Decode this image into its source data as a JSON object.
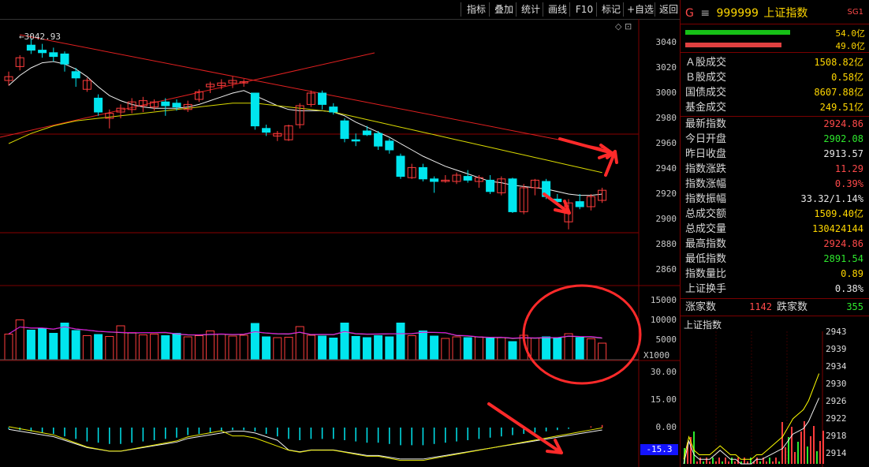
{
  "toolbar": {
    "buttons": [
      "指标",
      "叠加",
      "统计",
      "画线",
      "F10",
      "标记",
      "+自选",
      "返回"
    ]
  },
  "main_chart": {
    "y_ticks": [
      "3040",
      "3020",
      "3000",
      "2980",
      "2960",
      "2940",
      "2920",
      "2900",
      "2880",
      "2860"
    ],
    "high_label": "3042.93",
    "up_color": "#ff3c3c",
    "down_color": "#00e5ee"
  },
  "volume_chart": {
    "y_ticks": [
      "15000",
      "10000",
      "5000"
    ],
    "unit": "X1000"
  },
  "macd_chart": {
    "y_ticks": [
      "30.00",
      "15.00",
      "0.00"
    ],
    "current_value": "-15.3"
  },
  "chart_data": {
    "type": "candlestick",
    "ylim": [
      2850,
      3050
    ],
    "candles": [
      {
        "o": 3010,
        "h": 3017,
        "l": 3006,
        "c": 3013
      },
      {
        "o": 3021,
        "h": 3030,
        "l": 3018,
        "c": 3028
      },
      {
        "o": 3038,
        "h": 3043,
        "l": 3031,
        "c": 3034
      },
      {
        "o": 3034,
        "h": 3039,
        "l": 3028,
        "c": 3032
      },
      {
        "o": 3032,
        "h": 3036,
        "l": 3025,
        "c": 3029
      },
      {
        "o": 3031,
        "h": 3033,
        "l": 3017,
        "c": 3023
      },
      {
        "o": 3017,
        "h": 3020,
        "l": 3005,
        "c": 3012
      },
      {
        "o": 3003,
        "h": 3012,
        "l": 3001,
        "c": 3010
      },
      {
        "o": 2996,
        "h": 2999,
        "l": 2982,
        "c": 2985
      },
      {
        "o": 2980,
        "h": 2987,
        "l": 2972,
        "c": 2984
      },
      {
        "o": 2985,
        "h": 2991,
        "l": 2980,
        "c": 2988
      },
      {
        "o": 2987,
        "h": 2996,
        "l": 2984,
        "c": 2993
      },
      {
        "o": 2990,
        "h": 2997,
        "l": 2985,
        "c": 2994
      },
      {
        "o": 2989,
        "h": 2995,
        "l": 2986,
        "c": 2993
      },
      {
        "o": 2993,
        "h": 2996,
        "l": 2982,
        "c": 2990
      },
      {
        "o": 2992,
        "h": 2995,
        "l": 2986,
        "c": 2989
      },
      {
        "o": 2987,
        "h": 2994,
        "l": 2985,
        "c": 2991
      },
      {
        "o": 2995,
        "h": 3003,
        "l": 2993,
        "c": 3001
      },
      {
        "o": 3005,
        "h": 3009,
        "l": 3000,
        "c": 3007
      },
      {
        "o": 3006,
        "h": 3011,
        "l": 3003,
        "c": 3008
      },
      {
        "o": 3008,
        "h": 3013,
        "l": 3004,
        "c": 3010
      },
      {
        "o": 3008,
        "h": 3011,
        "l": 3005,
        "c": 3009
      },
      {
        "o": 3000,
        "h": 3000,
        "l": 2971,
        "c": 2974
      },
      {
        "o": 2972,
        "h": 2975,
        "l": 2966,
        "c": 2969
      },
      {
        "o": 2966,
        "h": 2970,
        "l": 2962,
        "c": 2968
      },
      {
        "o": 2963,
        "h": 2975,
        "l": 2962,
        "c": 2974
      },
      {
        "o": 2975,
        "h": 2992,
        "l": 2972,
        "c": 2990
      },
      {
        "o": 2991,
        "h": 3002,
        "l": 2989,
        "c": 3000
      },
      {
        "o": 3000,
        "h": 3002,
        "l": 2987,
        "c": 2991
      },
      {
        "o": 2989,
        "h": 2992,
        "l": 2983,
        "c": 2985
      },
      {
        "o": 2978,
        "h": 2980,
        "l": 2961,
        "c": 2964
      },
      {
        "o": 2963,
        "h": 2968,
        "l": 2958,
        "c": 2962
      },
      {
        "o": 2970,
        "h": 2974,
        "l": 2966,
        "c": 2967
      },
      {
        "o": 2968,
        "h": 2970,
        "l": 2955,
        "c": 2958
      },
      {
        "o": 2962,
        "h": 2964,
        "l": 2952,
        "c": 2955
      },
      {
        "o": 2950,
        "h": 2952,
        "l": 2932,
        "c": 2934
      },
      {
        "o": 2933,
        "h": 2944,
        "l": 2932,
        "c": 2941
      },
      {
        "o": 2941,
        "h": 2944,
        "l": 2930,
        "c": 2932
      },
      {
        "o": 2932,
        "h": 2934,
        "l": 2921,
        "c": 2930
      },
      {
        "o": 2930,
        "h": 2935,
        "l": 2929,
        "c": 2931
      },
      {
        "o": 2930,
        "h": 2937,
        "l": 2928,
        "c": 2935
      },
      {
        "o": 2934,
        "h": 2939,
        "l": 2929,
        "c": 2931
      },
      {
        "o": 2930,
        "h": 2935,
        "l": 2925,
        "c": 2933
      },
      {
        "o": 2931,
        "h": 2935,
        "l": 2920,
        "c": 2922
      },
      {
        "o": 2921,
        "h": 2934,
        "l": 2919,
        "c": 2932
      },
      {
        "o": 2932,
        "h": 2933,
        "l": 2905,
        "c": 2906
      },
      {
        "o": 2906,
        "h": 2928,
        "l": 2904,
        "c": 2925
      },
      {
        "o": 2925,
        "h": 2932,
        "l": 2919,
        "c": 2931
      },
      {
        "o": 2930,
        "h": 2932,
        "l": 2916,
        "c": 2918
      },
      {
        "o": 2916,
        "h": 2920,
        "l": 2912,
        "c": 2914
      },
      {
        "o": 2898,
        "h": 2916,
        "l": 2892,
        "c": 2913
      },
      {
        "o": 2914,
        "h": 2920,
        "l": 2908,
        "c": 2910
      },
      {
        "o": 2910,
        "h": 2920,
        "l": 2907,
        "c": 2918
      },
      {
        "o": 2915,
        "h": 2925,
        "l": 2913,
        "c": 2923
      }
    ],
    "ma_white": [
      3006,
      3014,
      3020,
      3024,
      3025,
      3023,
      3019,
      3013,
      3005,
      2998,
      2994,
      2991,
      2989,
      2988,
      2988,
      2988,
      2989,
      2991,
      2994,
      2997,
      3000,
      3002,
      2998,
      2994,
      2990,
      2987,
      2986,
      2986,
      2986,
      2985,
      2982,
      2977,
      2973,
      2969,
      2965,
      2960,
      2955,
      2950,
      2946,
      2942,
      2939,
      2936,
      2933,
      2930,
      2929,
      2927,
      2926,
      2925,
      2924,
      2922,
      2920,
      2919,
      2919,
      2920
    ],
    "ma_yellow": [
      2960,
      2964,
      2968,
      2971,
      2974,
      2976,
      2978,
      2979,
      2980,
      2981,
      2982,
      2983,
      2984,
      2985,
      2986,
      2987,
      2988,
      2989,
      2990,
      2991,
      2992,
      2992,
      2992,
      2991,
      2990,
      2989,
      2988,
      2987,
      2986,
      2985,
      2983,
      2981,
      2979,
      2977,
      2975,
      2973,
      2971,
      2969,
      2967,
      2965,
      2963,
      2961,
      2959,
      2957,
      2955,
      2953,
      2951,
      2949,
      2947,
      2945,
      2943,
      2941,
      2939,
      2937
    ],
    "volumes": [
      6500,
      10100,
      7500,
      8000,
      6700,
      9300,
      7400,
      6100,
      6400,
      5900,
      8600,
      6900,
      6300,
      6500,
      6100,
      6700,
      5800,
      6100,
      7300,
      6500,
      6000,
      6200,
      9200,
      5800,
      5600,
      5700,
      8400,
      6200,
      6000,
      5500,
      9300,
      5900,
      5600,
      6100,
      5800,
      9300,
      6100,
      7300,
      6000,
      5400,
      5800,
      5600,
      5800,
      5400,
      5600,
      4600,
      6200,
      5500,
      5800,
      5600,
      6600,
      5600,
      5300,
      4200
    ],
    "macd_hist": [
      -1,
      -2,
      -3,
      -4,
      -5,
      -7,
      -9,
      -11,
      -12,
      -13,
      -13,
      -12,
      -11,
      -10,
      -9,
      -8,
      -6,
      -5,
      -4,
      -3,
      -2,
      -2,
      -3,
      -5,
      -7,
      -9,
      -10,
      -9,
      -9,
      -9,
      -10,
      -11,
      -12,
      -12,
      -13,
      -14,
      -14,
      -14,
      -13,
      -12,
      -11,
      -10,
      -9,
      -8,
      -7,
      -6,
      -5,
      -4,
      -3,
      -2,
      -1,
      0,
      1,
      2
    ]
  },
  "info_panel": {
    "header": {
      "flag": "G",
      "menu_icon": "≡",
      "code": "999999",
      "name": "上证指数",
      "tag": "SG1"
    },
    "bars": [
      {
        "value": "54.0亿",
        "color": "#16c016",
        "fill": 0.7
      },
      {
        "value": "49.0亿",
        "color": "#e04040",
        "fill": 0.64
      }
    ],
    "turnover": [
      {
        "label": "Ａ股成交",
        "value": "1508.82亿",
        "cls": "yellow"
      },
      {
        "label": "Ｂ股成交",
        "value": "0.58亿",
        "cls": "yellow"
      },
      {
        "label": "国债成交",
        "value": "8607.88亿",
        "cls": "yellow"
      },
      {
        "label": "基金成交",
        "value": "249.51亿",
        "cls": "yellow"
      }
    ],
    "stats": [
      {
        "label": "最新指数",
        "value": "2924.86",
        "cls": "red"
      },
      {
        "label": "今日开盘",
        "value": "2902.08",
        "cls": "green"
      },
      {
        "label": "昨日收盘",
        "value": "2913.57",
        "cls": "white"
      },
      {
        "label": "指数涨跌",
        "value": "11.29",
        "cls": "red"
      },
      {
        "label": "指数涨幅",
        "value": "0.39%",
        "cls": "red"
      },
      {
        "label": "指数振幅",
        "value": "33.32/1.14%",
        "cls": "white"
      },
      {
        "label": "总成交额",
        "value": "1509.40亿",
        "cls": "yellow"
      },
      {
        "label": "总成交量",
        "value": "130424144",
        "cls": "yellow"
      },
      {
        "label": "最高指数",
        "value": "2924.86",
        "cls": "red"
      },
      {
        "label": "最低指数",
        "value": "2891.54",
        "cls": "green"
      },
      {
        "label": "指数量比",
        "value": "0.89",
        "cls": "yellow"
      },
      {
        "label": "上证换手",
        "value": "0.38%",
        "cls": "white"
      }
    ],
    "breadth": {
      "up_label": "涨家数",
      "up_value": "1142",
      "down_label": "跌家数",
      "down_value": "355"
    },
    "mini_chart": {
      "title": "上证指数",
      "y_ticks": [
        "2943",
        "2939",
        "2934",
        "2930",
        "2926",
        "2922",
        "2918",
        "2914"
      ]
    }
  }
}
